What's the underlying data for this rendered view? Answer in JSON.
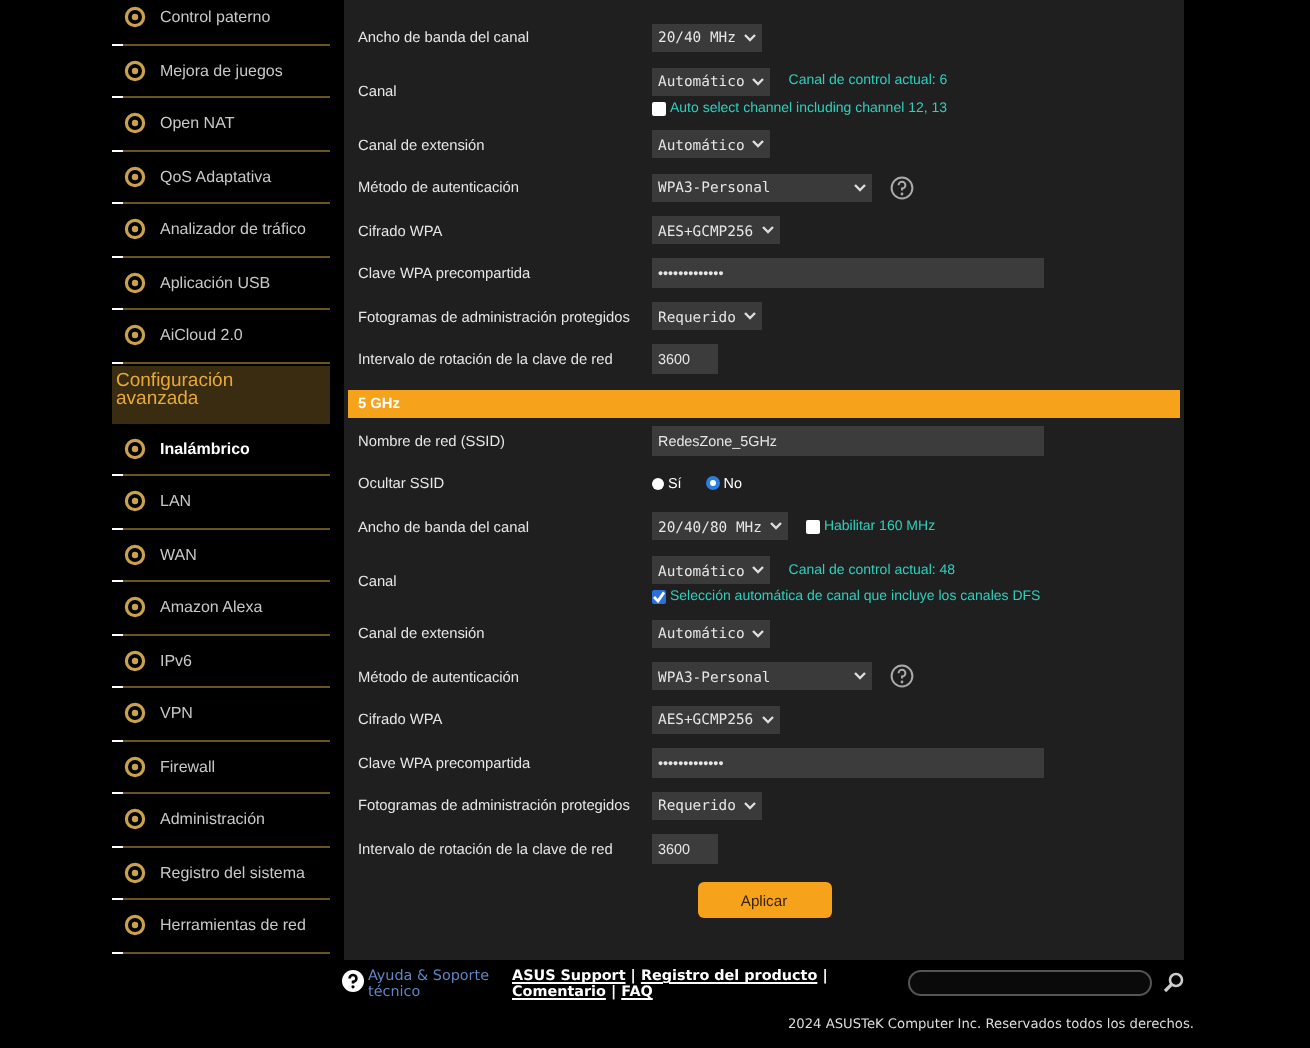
{
  "sidebar": {
    "items_top": [
      {
        "label": "Control paterno",
        "selected": false
      },
      {
        "label": "Mejora de juegos",
        "selected": false
      },
      {
        "label": "Open NAT",
        "selected": false
      },
      {
        "label": "QoS Adaptativa",
        "selected": false
      },
      {
        "label": "Analizador de tráfico",
        "selected": false
      },
      {
        "label": "Aplicación USB",
        "selected": false
      },
      {
        "label": "AiCloud 2.0",
        "selected": false
      }
    ],
    "section_title": "Configuración avanzada",
    "items": [
      {
        "label": "Inalámbrico",
        "selected": true
      },
      {
        "label": "LAN",
        "selected": false
      },
      {
        "label": "WAN",
        "selected": false
      },
      {
        "label": "Amazon Alexa",
        "selected": false
      },
      {
        "label": "IPv6",
        "selected": false
      },
      {
        "label": "VPN",
        "selected": false
      },
      {
        "label": "Firewall",
        "selected": false
      },
      {
        "label": "Administración",
        "selected": false
      },
      {
        "label": "Registro del sistema",
        "selected": false
      },
      {
        "label": "Herramientas de red",
        "selected": false
      }
    ]
  },
  "sections": [
    {
      "rows": [
        {
          "kind": "select",
          "label": "Ancho de banda del canal",
          "value": "20/40 MHz"
        },
        {
          "kind": "channel",
          "label": "Canal",
          "value": "Automático",
          "note": "Canal de control actual: 6",
          "option": {
            "label": "Auto select channel including channel 12, 13",
            "checked": false
          }
        },
        {
          "kind": "select",
          "label": "Canal de extensión",
          "value": "Automático"
        },
        {
          "kind": "select_help",
          "label": "Método de autenticación",
          "value": "WPA3-Personal"
        },
        {
          "kind": "select",
          "label": "Cifrado WPA",
          "value": "AES+GCMP256"
        },
        {
          "kind": "password",
          "label": "Clave WPA precompartida",
          "value": "•••••••••••••"
        },
        {
          "kind": "select",
          "label": "Fotogramas de administración protegidos",
          "value": "Requerido"
        },
        {
          "kind": "number",
          "label": "Intervalo de rotación de la clave de red",
          "value": "3600"
        }
      ]
    },
    {
      "header": "5 GHz",
      "rows": [
        {
          "kind": "text",
          "label": "Nombre de red (SSID)",
          "value": "RedesZone_5GHz"
        },
        {
          "kind": "radio",
          "label": "Ocultar SSID",
          "options": [
            {
              "label": "Sí",
              "selected": false
            },
            {
              "label": "No",
              "selected": true
            }
          ]
        },
        {
          "kind": "select_check",
          "label": "Ancho de banda del canal",
          "value": "20/40/80 MHz",
          "option": {
            "label": "Habilitar 160 MHz",
            "checked": false
          }
        },
        {
          "kind": "channel",
          "label": "Canal",
          "value": "Automático",
          "note": "Canal de control actual: 48",
          "option": {
            "label": "Selección automática de canal que incluye los canales DFS",
            "checked": true
          }
        },
        {
          "kind": "select",
          "label": "Canal de extensión",
          "value": "Automático"
        },
        {
          "kind": "select_help",
          "label": "Método de autenticación",
          "value": "WPA3-Personal"
        },
        {
          "kind": "select",
          "label": "Cifrado WPA",
          "value": "AES+GCMP256"
        },
        {
          "kind": "password",
          "label": "Clave WPA precompartida",
          "value": "•••••••••••••"
        },
        {
          "kind": "select",
          "label": "Fotogramas de administración protegidos",
          "value": "Requerido"
        },
        {
          "kind": "number",
          "label": "Intervalo de rotación de la clave de red",
          "value": "3600"
        }
      ]
    }
  ],
  "apply_button": "Aplicar",
  "footer": {
    "help_label": "Ayuda & Soporte técnico",
    "links": [
      "ASUS Support",
      "Registro del producto",
      "Comentario",
      "FAQ"
    ],
    "separator": "|",
    "copyright": "2024 ASUSTeK Computer Inc. Reservados todos los derechos."
  }
}
